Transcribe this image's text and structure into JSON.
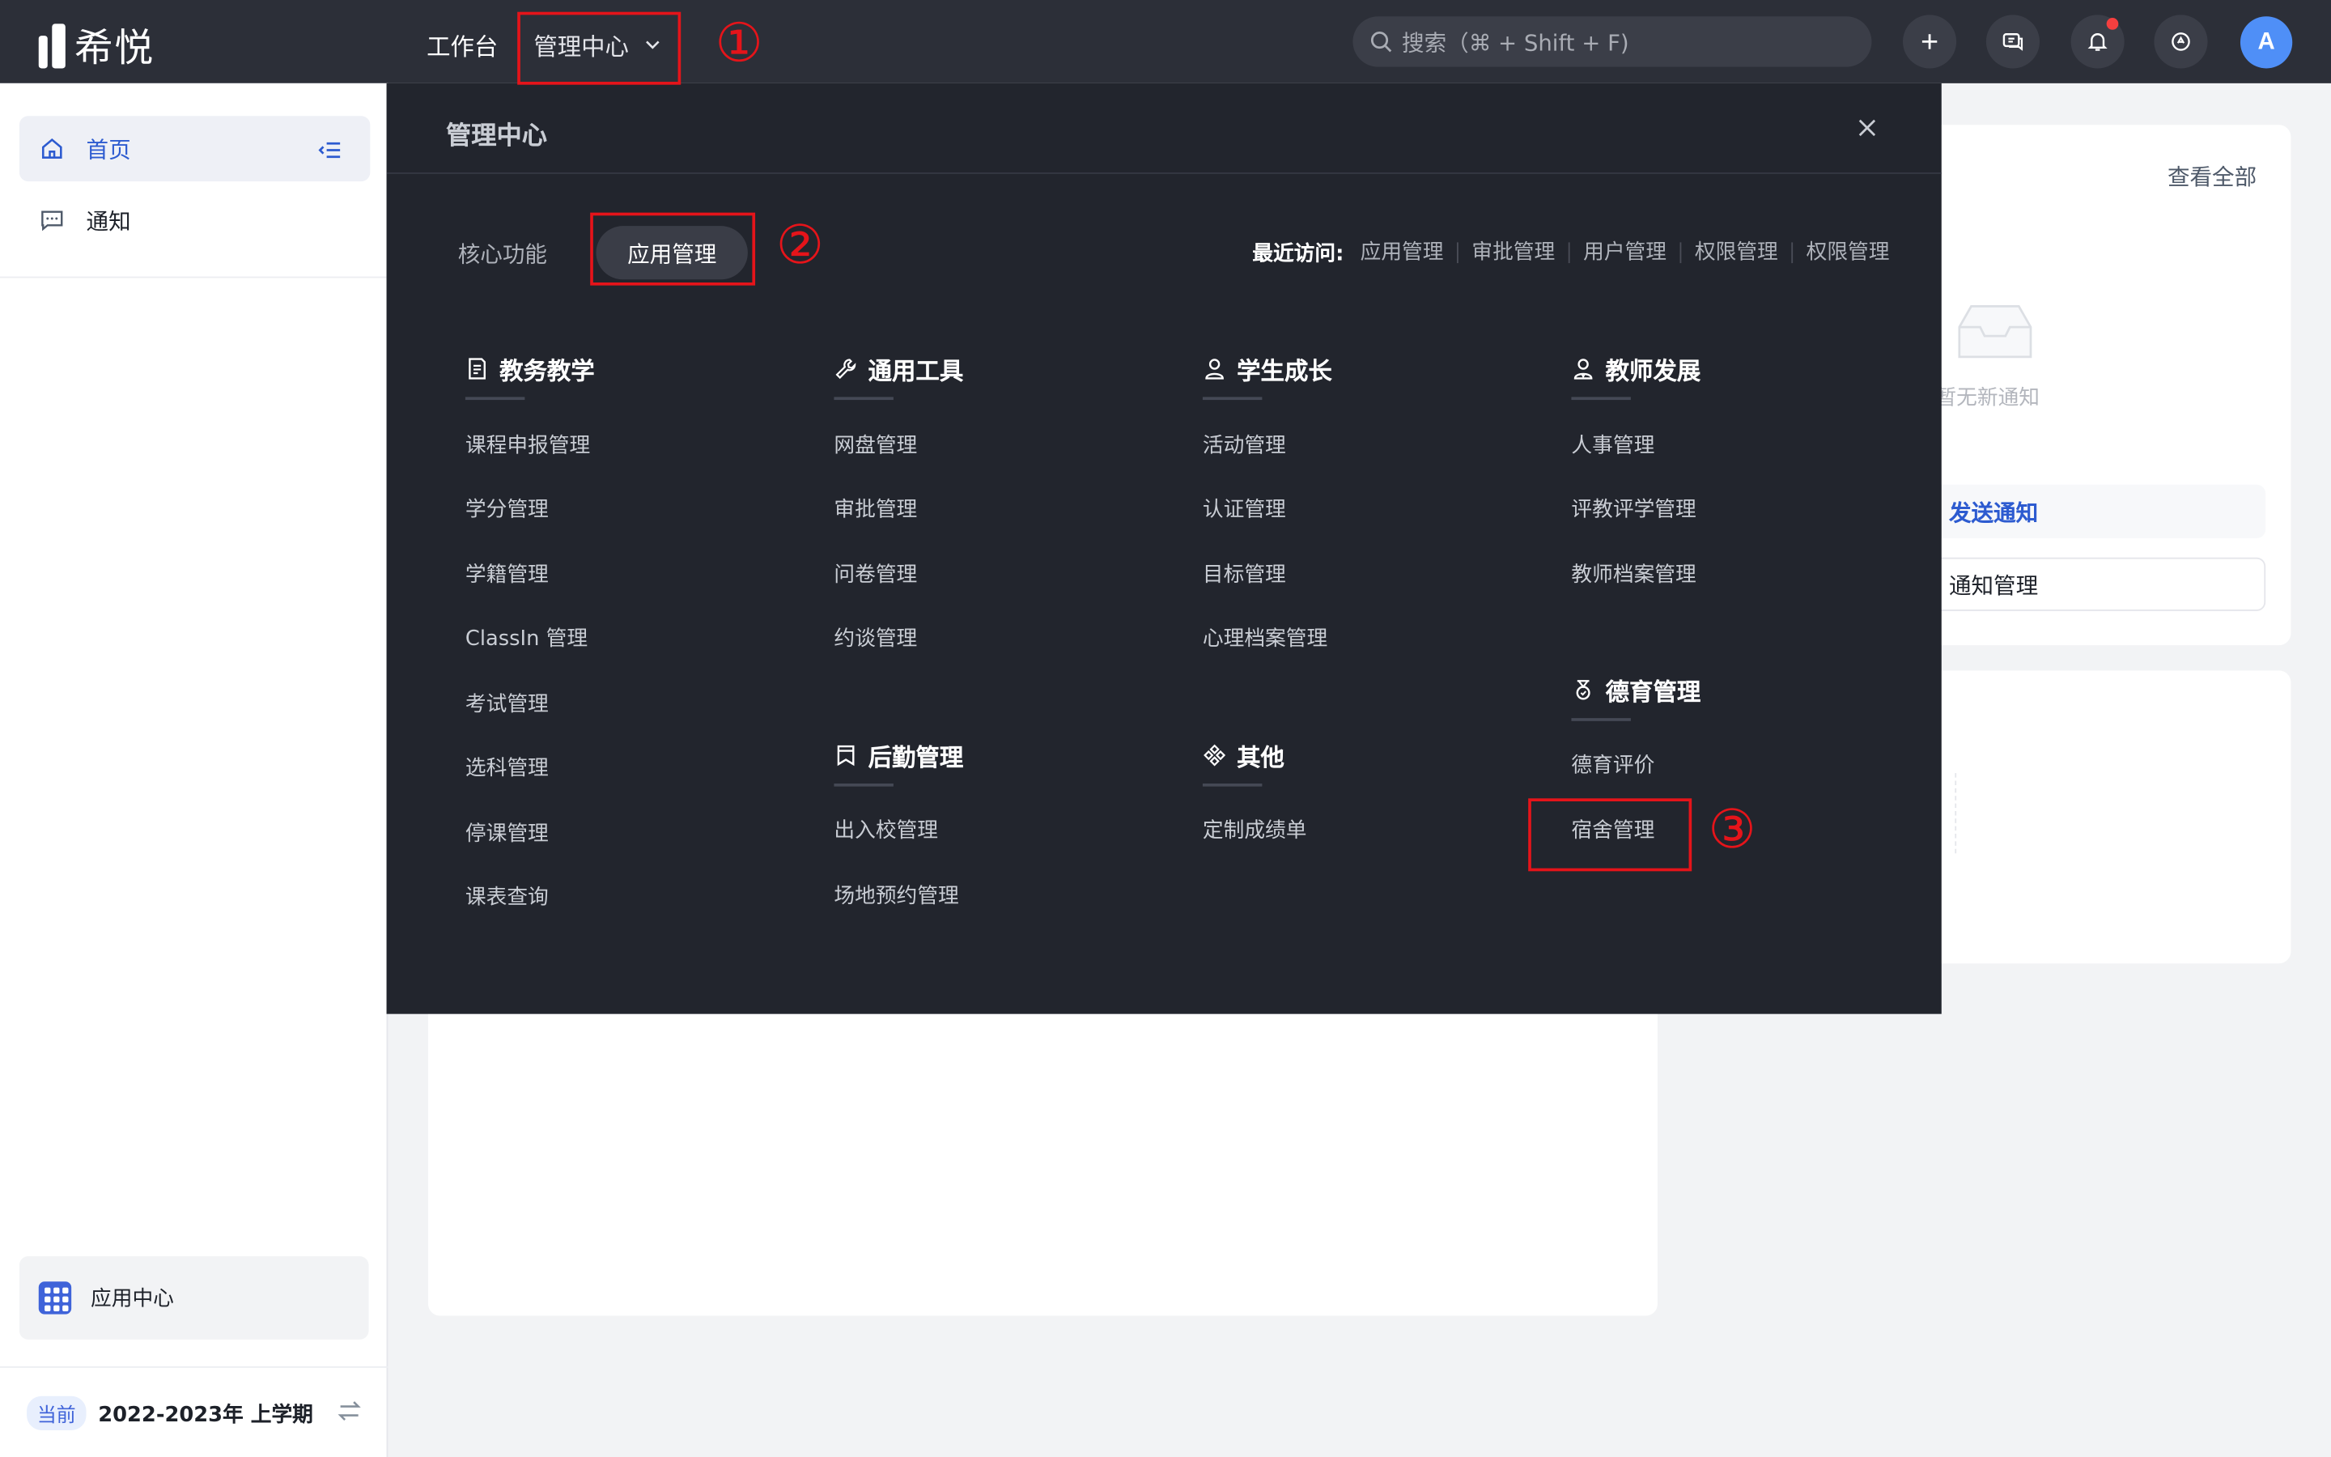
{
  "app": {
    "name": "希悦"
  },
  "topbar": {
    "nav_workbench": "工作台",
    "nav_admin": "管理中心",
    "search_placeholder": "搜索（⌘ + Shift + F)",
    "avatar_letter": "A"
  },
  "sidebar": {
    "home": "首页",
    "notice": "通知",
    "app_center": "应用中心",
    "term_badge": "当前",
    "term_label": "2022-2023年 上学期"
  },
  "background": {
    "view_all": "查看全部",
    "empty_text": "暂无新通知",
    "send_notice": "发送通知",
    "notice_manage": "通知管理"
  },
  "panel": {
    "title": "管理中心",
    "tab_core": "核心功能",
    "tab_apps": "应用管理",
    "recent_label": "最近访问:",
    "recent": [
      "应用管理",
      "审批管理",
      "用户管理",
      "权限管理",
      "权限管理"
    ],
    "columns": {
      "teaching": {
        "title": "教务教学",
        "items": [
          "课程申报管理",
          "学分管理",
          "学籍管理",
          "ClassIn 管理",
          "考试管理",
          "选科管理",
          "停课管理",
          "课表查询"
        ]
      },
      "tools": {
        "title": "通用工具",
        "items": [
          "网盘管理",
          "审批管理",
          "问卷管理",
          "约谈管理"
        ]
      },
      "logistics": {
        "title": "后勤管理",
        "items": [
          "出入校管理",
          "场地预约管理"
        ]
      },
      "growth": {
        "title": "学生成长",
        "items": [
          "活动管理",
          "认证管理",
          "目标管理",
          "心理档案管理"
        ]
      },
      "other": {
        "title": "其他",
        "items": [
          "定制成绩单"
        ]
      },
      "teacher": {
        "title": "教师发展",
        "items": [
          "人事管理",
          "评教评学管理",
          "教师档案管理"
        ]
      },
      "moral": {
        "title": "德育管理",
        "items": [
          "德育评价",
          "宿舍管理"
        ]
      }
    }
  },
  "annotations": {
    "n1": "①",
    "n2": "②",
    "n3": "③",
    "color": "#e5141a"
  },
  "colors": {
    "topbar": "#2c2f38",
    "panel": "#22252d",
    "accent": "#2d5bd0",
    "avatar": "#4f8ff7"
  }
}
